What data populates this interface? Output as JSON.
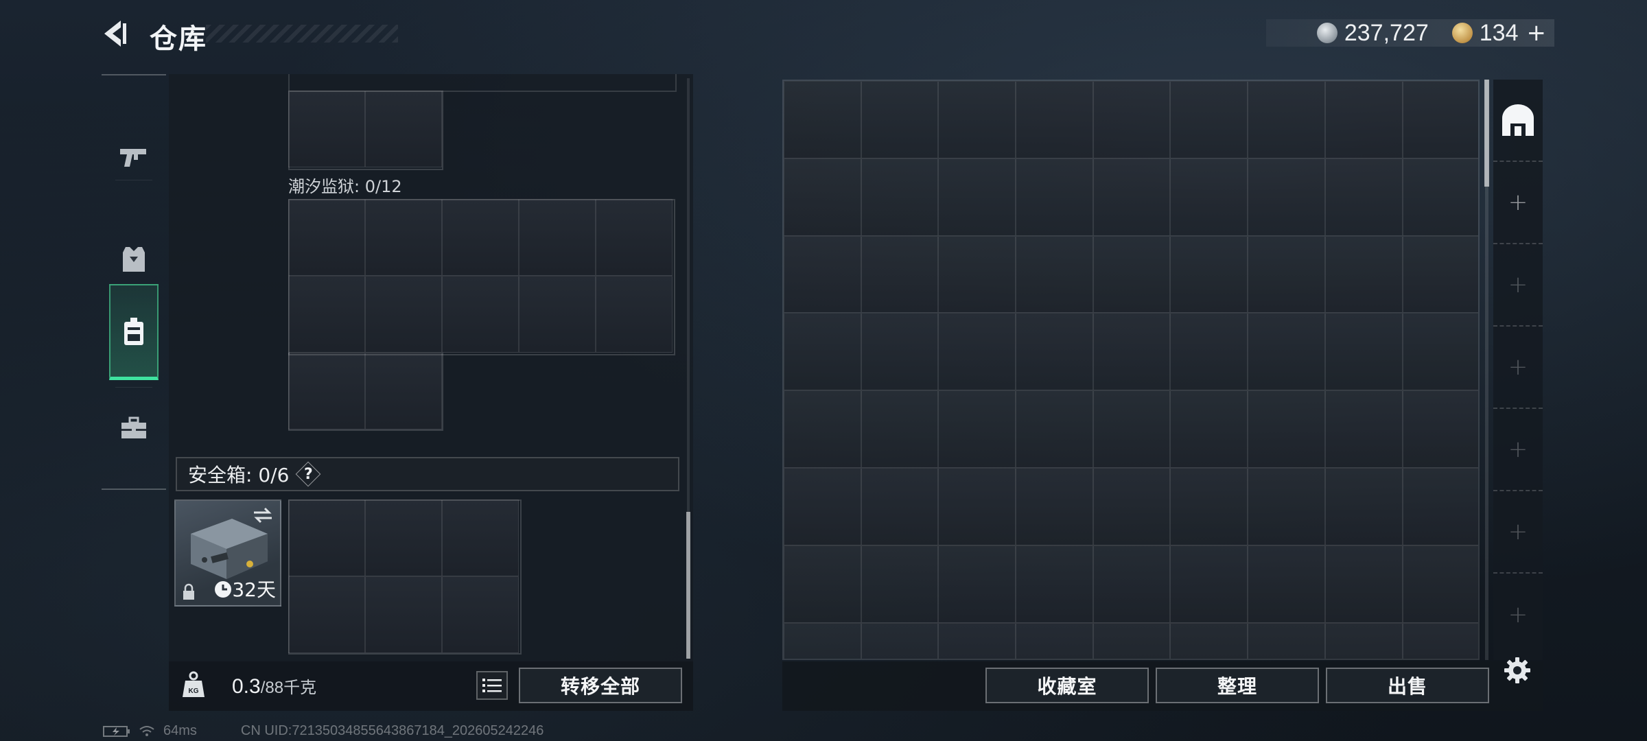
{
  "header": {
    "title": "仓库",
    "currencies": [
      {
        "icon": "silver-coin-icon",
        "value": "237,727"
      },
      {
        "icon": "gold-coin-icon",
        "value": "134"
      }
    ],
    "add_label": "+"
  },
  "sidebar": {
    "tabs": [
      {
        "name": "weapons",
        "icon": "pistol-icon",
        "active": false
      },
      {
        "name": "armor",
        "icon": "vest-icon",
        "active": false
      },
      {
        "name": "backpack",
        "icon": "backpack-icon",
        "active": true
      },
      {
        "name": "toolbox",
        "icon": "toolbox-icon",
        "active": false
      }
    ]
  },
  "loadout": {
    "section_label": "潮汐监狱: 0/12",
    "safe_box": {
      "label": "安全箱: 0/6",
      "help": "?",
      "days": "32天"
    },
    "weight": {
      "current": "0.3",
      "max": "/88千克"
    },
    "transfer_label": "转移全部"
  },
  "stash": {
    "buttons": [
      "收藏室",
      "整理",
      "出售"
    ],
    "side_slots": [
      "+",
      "+",
      "+",
      "+",
      "+",
      "+"
    ]
  },
  "status_bar": {
    "ping": "64ms",
    "uid": "CN UID:72135034855643867184_202605242246"
  },
  "colors": {
    "accent": "#3fe3a0",
    "panel": "#161c23"
  }
}
